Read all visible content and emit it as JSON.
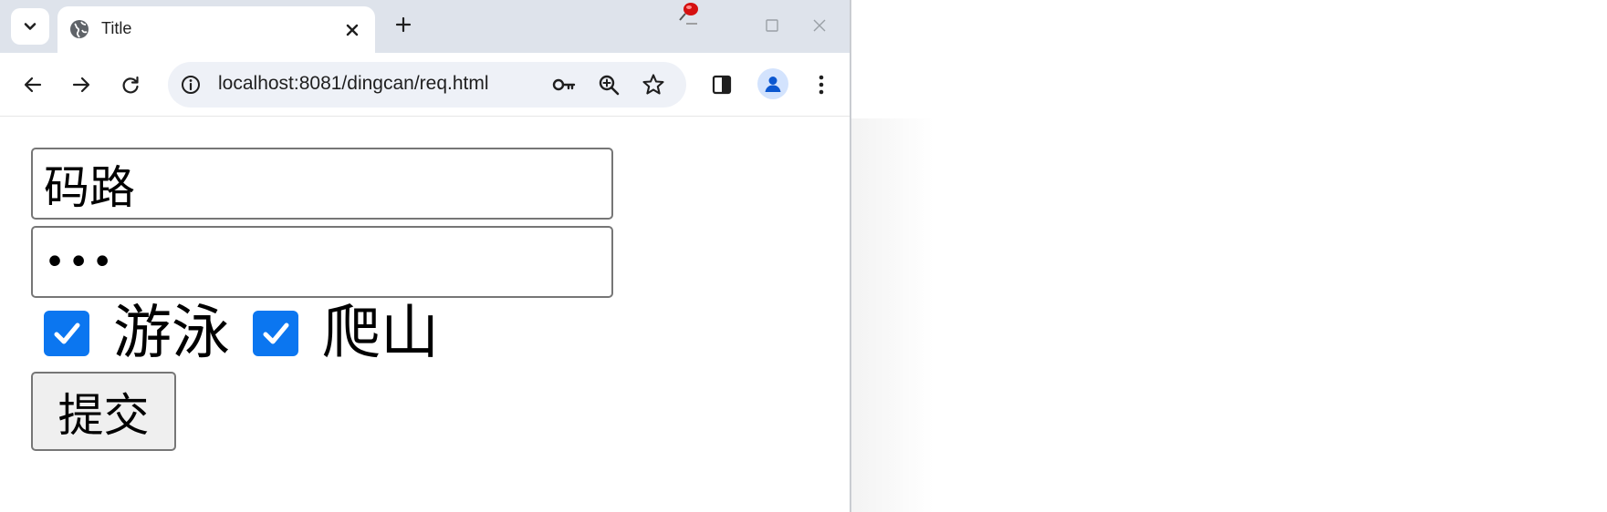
{
  "window": {
    "tab_title": "Title",
    "url": "localhost:8081/dingcan/req.html",
    "icons": {
      "tab_search": "chevron-down-icon",
      "favicon": "globe-icon",
      "tab_close": "close-icon",
      "new_tab": "plus-icon",
      "pin": "pushpin-icon",
      "minimize": "minimize-icon",
      "maximize": "maximize-icon",
      "close": "close-icon"
    }
  },
  "toolbar": {
    "icons": [
      "arrow-left-icon",
      "arrow-right-icon",
      "reload-icon",
      "site-info-icon",
      "key-icon",
      "zoom-icon",
      "star-icon",
      "side-panel-icon",
      "profile-icon",
      "more-icon"
    ]
  },
  "form": {
    "username_value": "码路",
    "password_value": "•••",
    "checkboxes": [
      {
        "label": "游泳",
        "checked": true
      },
      {
        "label": "爬山",
        "checked": true
      }
    ],
    "submit_label": "提交"
  },
  "colors": {
    "tabstrip_bg": "#dee3eb",
    "omnibox_bg": "#eef1f7",
    "checkbox_accent": "#0b76f0",
    "button_bg": "#efefef",
    "input_border": "#767676"
  }
}
